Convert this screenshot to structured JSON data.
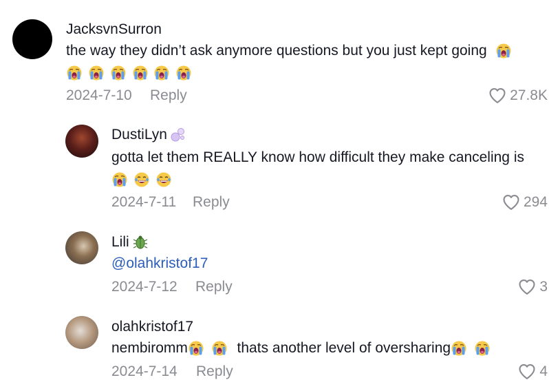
{
  "comments": [
    {
      "username": "JacksvnSurron",
      "line1": "the way they didn’t ask anymore questions but you just kept going",
      "date": "2024-7-10",
      "reply_label": "Reply",
      "likes": "27.8K"
    },
    {
      "username": "DustiLyn",
      "line1": "gotta let them REALLY know how difficult they make canceling is",
      "date": "2024-7-11",
      "reply_label": "Reply",
      "likes": "294"
    },
    {
      "username": "Lili",
      "mention": "@olahkristof17",
      "date": "2024-7-12",
      "reply_label": "Reply",
      "likes": "3"
    },
    {
      "username": "olahkristof17",
      "line1a": "nembiromm",
      "line1b": "thats another level of oversharing",
      "date": "2024-7-14",
      "reply_label": "Reply",
      "likes": "4"
    }
  ],
  "icons": {
    "crying": "loudly-crying-face-icon",
    "laughing": "tears-of-joy-face-icon",
    "bubbles": "bubbles-icon",
    "beetle": "beetle-icon",
    "like": "heart-outline-icon"
  }
}
